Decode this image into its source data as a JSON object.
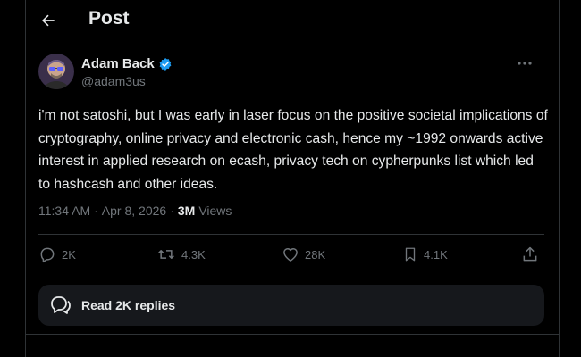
{
  "header": {
    "title": "Post"
  },
  "author": {
    "display_name": "Adam Back",
    "handle": "@adam3us",
    "verified_color": "#1d9bf0"
  },
  "tweet": {
    "text": "i'm not satoshi, but I was early in laser focus on the positive societal implications of cryptography, online privacy and electronic cash, hence my ~1992 onwards active interest in applied research on ecash, privacy tech on cypherpunks list which led to hashcash and other ideas.",
    "time": "11:34 AM",
    "date": "Apr 8, 2026",
    "views_count": "3M",
    "views_label": "Views"
  },
  "actions": {
    "replies": "2K",
    "reposts": "4.3K",
    "likes": "28K",
    "bookmarks": "4.1K"
  },
  "read_replies": {
    "label": "Read 2K replies"
  },
  "icons": {
    "back": "back-arrow-icon",
    "verified": "verified-badge-icon",
    "more": "more-icon",
    "reply": "reply-icon",
    "repost": "repost-icon",
    "like": "heart-icon",
    "bookmark": "bookmark-icon",
    "share": "share-icon",
    "replies_bubble": "replies-bubble-icon"
  },
  "colors": {
    "background": "#000000",
    "text": "#e7e9ea",
    "muted": "#71767b",
    "accent": "#1d9bf0"
  }
}
